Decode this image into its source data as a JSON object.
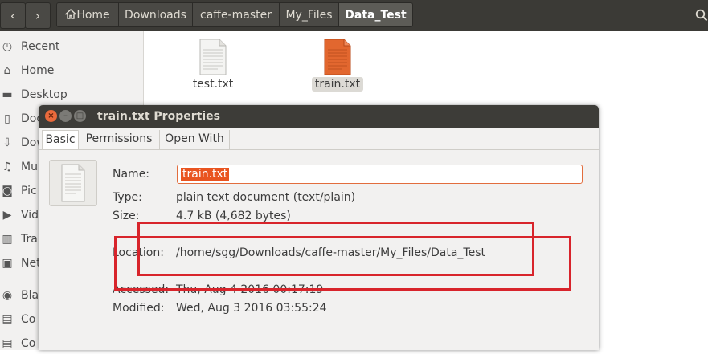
{
  "pathbar": {
    "back_icon": "chevron-left-icon",
    "forward_icon": "chevron-right-icon",
    "crumbs": [
      "Home",
      "Downloads",
      "caffe-master",
      "My_Files",
      "Data_Test"
    ],
    "search_icon": "search-icon"
  },
  "sidebar": {
    "items": [
      {
        "label": "Recent",
        "icon": "clock-icon"
      },
      {
        "label": "Home",
        "icon": "home-icon"
      },
      {
        "label": "Desktop",
        "icon": "desktop-icon"
      },
      {
        "label": "Doc",
        "icon": "documents-icon"
      },
      {
        "label": "Dow",
        "icon": "downloads-icon"
      },
      {
        "label": "Mu",
        "icon": "music-icon"
      },
      {
        "label": "Pic",
        "icon": "pictures-icon"
      },
      {
        "label": "Vid",
        "icon": "videos-icon"
      },
      {
        "label": "Tra",
        "icon": "trash-icon"
      },
      {
        "label": "Net",
        "icon": "network-icon"
      },
      {
        "label": "Bla",
        "icon": "disk-icon"
      },
      {
        "label": "Co",
        "icon": "computer-icon"
      },
      {
        "label": "Co",
        "icon": "computer-icon"
      }
    ]
  },
  "files": [
    {
      "name": "test.txt",
      "selected": false,
      "color": "#f4f4f2"
    },
    {
      "name": "train.txt",
      "selected": true,
      "color": "#e2672f"
    }
  ],
  "dialog": {
    "title": "train.txt Properties",
    "tabs": [
      "Basic",
      "Permissions",
      "Open With"
    ],
    "active_tab": "Basic",
    "fields": {
      "name_label": "Name:",
      "name_value": "train.txt",
      "type_label": "Type:",
      "type_value": "plain text document (text/plain)",
      "size_label": "Size:",
      "size_value": "4.7 kB (4,682 bytes)",
      "location_label": "Location:",
      "location_value": "/home/sgg/Downloads/caffe-master/My_Files/Data_Test",
      "accessed_label": "Accessed:",
      "accessed_value": "Thu, Aug  4 2016 00:17:19",
      "modified_label": "Modified:",
      "modified_value": "Wed, Aug  3 2016 03:55:24"
    }
  },
  "colors": {
    "accent": "#e95420",
    "annotation": "#d8242b"
  }
}
